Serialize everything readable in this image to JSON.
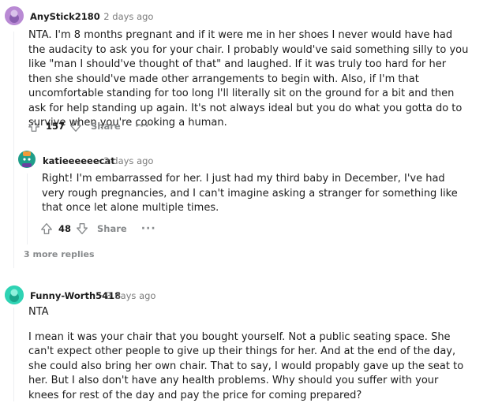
{
  "comments": [
    {
      "username": "AnyStick2180",
      "time": "· 2 days ago",
      "paragraphs": [
        "NTA. I'm 8 months pregnant and if it were me in her shoes I never would have had the audacity to ask you for your chair. I probably would've said something silly to you like \"man I should've thought of that\" and laughed. If it was truly too hard for her then she should've made other arrangements to begin with. Also, if I'm that uncomfortable standing for too long I'll literally sit on the ground for a bit and then ask for help standing up again. It's not always ideal but you do what you gotta do to survive when you're cooking a human."
      ],
      "score": "157",
      "share_label": "Share",
      "more_label": "···",
      "avatar_color": "#c9a0dc"
    },
    {
      "username": "katieeeeeecat",
      "time": "· 2 days ago",
      "paragraphs": [
        "Right! I'm embarrassed for her. I just had my third baby in December, I've had very rough pregnancies, and I can't imagine asking a stranger for something like that once let alone multiple times."
      ],
      "score": "48",
      "share_label": "Share",
      "more_label": "···",
      "avatar_color": "#1f9e8a"
    },
    {
      "username": "Funny-Worth5418",
      "time": "· 3 days ago",
      "paragraphs": [
        "NTA",
        "I mean it was your chair that you bought yourself. Not a public seating space. She can't expect other people to give up their things for her. And at the end of the day, she could also bring her own chair. That to say, I would propably gave up the seat to her. But I also don't have any health problems. Why should you suffer with your knees for rest of the day and pay the price for coming prepared?"
      ],
      "avatar_color": "#2fd3b4"
    }
  ],
  "more_replies": "3 more replies"
}
